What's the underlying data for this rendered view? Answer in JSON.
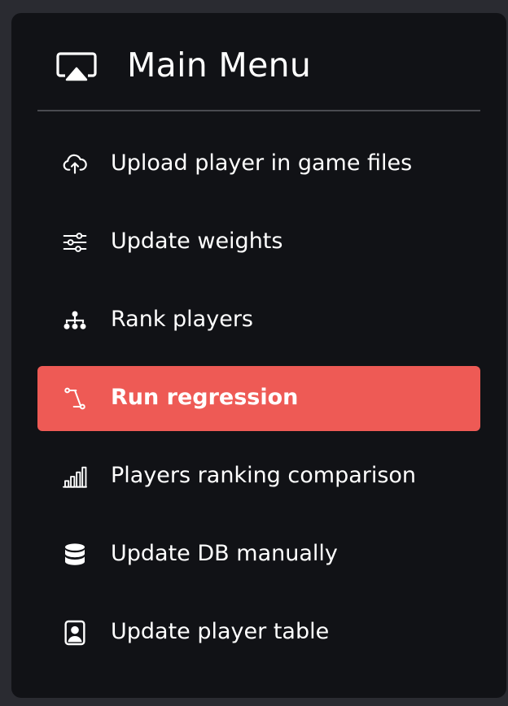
{
  "header": {
    "title": "Main Menu",
    "icon": "airplay-icon"
  },
  "menu": {
    "items": [
      {
        "label": "Upload player in game files",
        "icon": "cloud-upload-icon",
        "active": false
      },
      {
        "label": "Update weights",
        "icon": "sliders-icon",
        "active": false
      },
      {
        "label": "Rank players",
        "icon": "hierarchy-icon",
        "active": false
      },
      {
        "label": "Run regression",
        "icon": "vector-path-icon",
        "active": true
      },
      {
        "label": "Players ranking comparison",
        "icon": "bar-chart-icon",
        "active": false
      },
      {
        "label": "Update DB manually",
        "icon": "database-icon",
        "active": false
      },
      {
        "label": "Update player table",
        "icon": "person-badge-icon",
        "active": false
      }
    ]
  },
  "colors": {
    "background": "#2a2b31",
    "panel": "#111216",
    "active": "#ee5a55",
    "text": "#ffffff"
  }
}
